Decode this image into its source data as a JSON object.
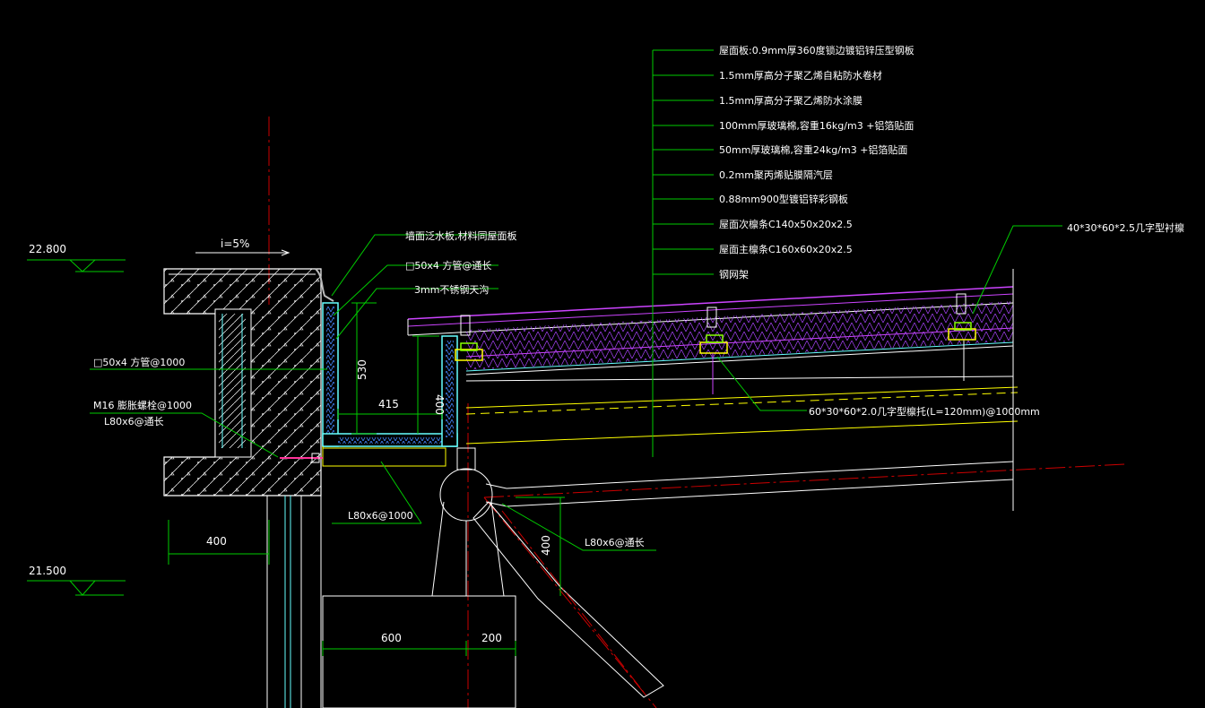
{
  "colors": {
    "background": "#000000",
    "leader": "#00cc00",
    "axis": "#cc0000",
    "structure": "#ffffff",
    "insulation": "#cc44ff",
    "flashing": "#66ffff",
    "roofing": "#ffff00",
    "blue_cover": "#4488ff"
  },
  "elevations": {
    "top": "22.800",
    "bottom": "21.500"
  },
  "slope": "i=5%",
  "layers": [
    "屋面板:0.9mm厚360度锁边镀铝锌压型钢板",
    "1.5mm厚高分子聚乙烯自粘防水卷材",
    "1.5mm厚高分子聚乙烯防水涂膜",
    "100mm厚玻璃棉,容重16kg/m3  +铝箔贴面",
    "50mm厚玻璃棉,容重24kg/m3  +铝箔贴面",
    "0.2mm聚丙烯贴膜隔汽层",
    "0.88mm900型镀铝锌彩钢板",
    "屋面次檩条C140x50x20x2.5",
    "屋面主檩条C160x60x20x2.5",
    "钢网架"
  ],
  "callouts": {
    "parapet_flashing": "墙面泛水板,材料同屋面板",
    "tube_top": "□50x4 方管@通长",
    "steel_gutter": "3mm不锈钢天沟",
    "tube_left": "□50x4 方管@1000",
    "bolt": "M16 膨胀螺栓@1000",
    "angle_long": "L80x6@通长",
    "angle_1000": "L80x6@1000",
    "angle_right": "L80x6@通长",
    "purlin_support": "60*30*60*2.0几字型檩托(L=120mm)@1000mm",
    "omega_bracket": "40*30*60*2.5几字型衬檩"
  },
  "dimensions": {
    "gutter_height": "530",
    "gutter_width": "415",
    "gutter_inner": "400",
    "wall_400": "400",
    "column_400": "400",
    "base_600": "600",
    "base_200": "200"
  }
}
